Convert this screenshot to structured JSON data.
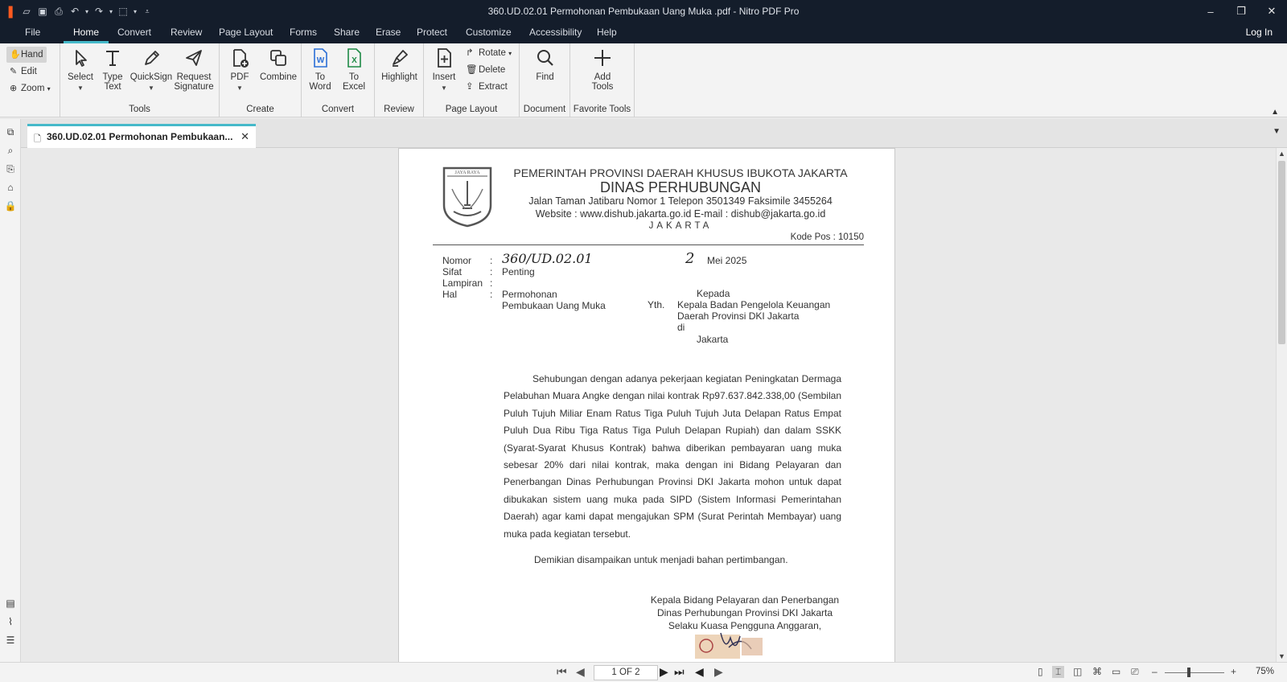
{
  "window": {
    "title": "360.UD.02.01 Permohonan Pembukaan Uang Muka .pdf - Nitro PDF Pro",
    "minimize": "–",
    "restore": "❐",
    "close": "✕"
  },
  "menu": {
    "tabs": [
      "File",
      "Home",
      "Convert",
      "Review",
      "Page Layout",
      "Forms",
      "Share",
      "Erase",
      "Protect",
      "Customize",
      "Accessibility",
      "Help"
    ],
    "active": "Home",
    "login": "Log In"
  },
  "ribbon": {
    "nav": {
      "hand": "Hand",
      "edit": "Edit",
      "zoom": "Zoom"
    },
    "tools": {
      "select": "Select",
      "type_text_1": "Type",
      "type_text_2": "Text",
      "quicksign": "QuickSign",
      "request_sig_1": "Request",
      "request_sig_2": "Signature",
      "label": "Tools"
    },
    "create": {
      "pdf": "PDF",
      "combine": "Combine",
      "label": "Create"
    },
    "convert": {
      "to_word_1": "To",
      "to_word_2": "Word",
      "to_excel_1": "To",
      "to_excel_2": "Excel",
      "label": "Convert"
    },
    "review": {
      "highlight": "Highlight",
      "label": "Review"
    },
    "page_layout": {
      "insert": "Insert",
      "rotate": "Rotate",
      "delete": "Delete",
      "extract": "Extract",
      "label": "Page Layout"
    },
    "document": {
      "find": "Find",
      "label": "Document"
    },
    "favorite": {
      "add_1": "Add",
      "add_2": "Tools",
      "label": "Favorite Tools"
    }
  },
  "doc_tab": {
    "title": "360.UD.02.01 Permohonan Pembukaan..."
  },
  "letter": {
    "seal_text": "JAYA  RAYA",
    "header": {
      "line1": "PEMERINTAH PROVINSI DAERAH KHUSUS IBUKOTA JAKARTA",
      "line2": "DINAS PERHUBUNGAN",
      "line3": "Jalan Taman Jatibaru Nomor 1 Telepon 3501349  Faksimile 3455264",
      "line4": "Website : www.dishub.jakarta.go.id   E-mail : dishub@jakarta.go.id",
      "line5": "JAKARTA",
      "kode_pos": "Kode Pos : 10150"
    },
    "meta": {
      "nomor_label": "Nomor",
      "sifat_label": "Sifat",
      "lampiran_label": "Lampiran",
      "hal_label": "Hal",
      "colon": ":",
      "nomor_value": "360/UD.02.01",
      "sifat_value": "Penting",
      "hal_value_1": "Permohonan",
      "hal_value_2": "Pembukaan Uang Muka",
      "date_day": "2",
      "date_rest": "Mei 2025",
      "yth": "Yth.",
      "kepada": "Kepada",
      "recipient_1": "Kepala Badan Pengelola Keuangan",
      "recipient_2": "Daerah Provinsi DKI Jakarta",
      "di": "di",
      "city": "Jakarta"
    },
    "body": "Sehubungan dengan adanya pekerjaan kegiatan Peningkatan Dermaga Pelabuhan Muara Angke dengan nilai kontrak Rp97.637.842.338,00 (Sembilan Puluh Tujuh Miliar Enam Ratus Tiga Puluh Tujuh Juta Delapan Ratus Empat Puluh Dua Ribu Tiga Ratus Tiga Puluh Delapan Rupiah) dan dalam SSKK (Syarat-Syarat Khusus Kontrak) bahwa diberikan pembayaran uang muka sebesar 20% dari nilai kontrak, maka dengan ini Bidang Pelayaran dan Penerbangan Dinas Perhubungan Provinsi DKI Jakarta mohon untuk dapat dibukakan sistem uang muka pada SIPD (Sistem Informasi Pemerintahan Daerah) agar kami dapat mengajukan SPM (Surat Perintah Membayar) uang muka pada kegiatan tersebut.",
    "closing": "Demikian disampaikan untuk menjadi bahan pertimbangan.",
    "signature": {
      "line1": "Kepala Bidang Pelayaran dan Penerbangan",
      "line2": "Dinas Perhubungan Provinsi DKI Jakarta",
      "line3": "Selaku Kuasa Pengguna Anggaran,"
    }
  },
  "status": {
    "page_indicator": "1 OF 2",
    "zoom_minus": "–",
    "zoom_plus": "+",
    "zoom_level": "75%"
  },
  "colors": {
    "titlebar": "#141d2b",
    "accent": "#45b9c9",
    "word_blue": "#2b6fd6",
    "excel_green": "#1e8a45"
  }
}
